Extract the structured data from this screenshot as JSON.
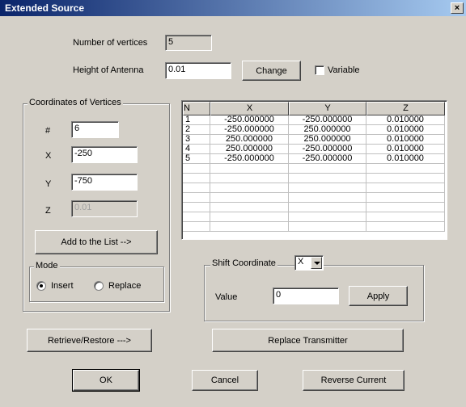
{
  "window": {
    "title": "Extended Source",
    "close_glyph": "×"
  },
  "top": {
    "num_vertices_label": "Number of vertices",
    "num_vertices_value": "5",
    "height_label": "Height of Antenna",
    "height_value": "0.01",
    "change_button": "Change",
    "variable_label": "Variable"
  },
  "coords": {
    "group_title": "Coordinates of Vertices",
    "hash_label": "#",
    "hash_value": "6",
    "x_label": "X",
    "x_value": "-250",
    "y_label": "Y",
    "y_value": "-750",
    "z_label": "Z",
    "z_value": "0.01",
    "add_button": "Add to the List -->"
  },
  "mode": {
    "group_title": "Mode",
    "insert_label": "Insert",
    "replace_label": "Replace",
    "selected": "Insert"
  },
  "table": {
    "headers": [
      "N",
      "X",
      "Y",
      "Z"
    ],
    "rows": [
      [
        "1",
        "-250.000000",
        "-250.000000",
        "0.010000"
      ],
      [
        "2",
        "-250.000000",
        "250.000000",
        "0.010000"
      ],
      [
        "3",
        "250.000000",
        "250.000000",
        "0.010000"
      ],
      [
        "4",
        "250.000000",
        "-250.000000",
        "0.010000"
      ],
      [
        "5",
        "-250.000000",
        "-250.000000",
        "0.010000"
      ]
    ],
    "empty_rows": 7
  },
  "shift": {
    "group_title": "Shift Coordinate",
    "axis_value": "X",
    "value_label": "Value",
    "value": "0",
    "apply_button": "Apply"
  },
  "buttons": {
    "retrieve": "Retrieve/Restore --->",
    "replace_transmitter": "Replace Transmitter",
    "ok": "OK",
    "cancel": "Cancel",
    "reverse": "Reverse Current"
  }
}
